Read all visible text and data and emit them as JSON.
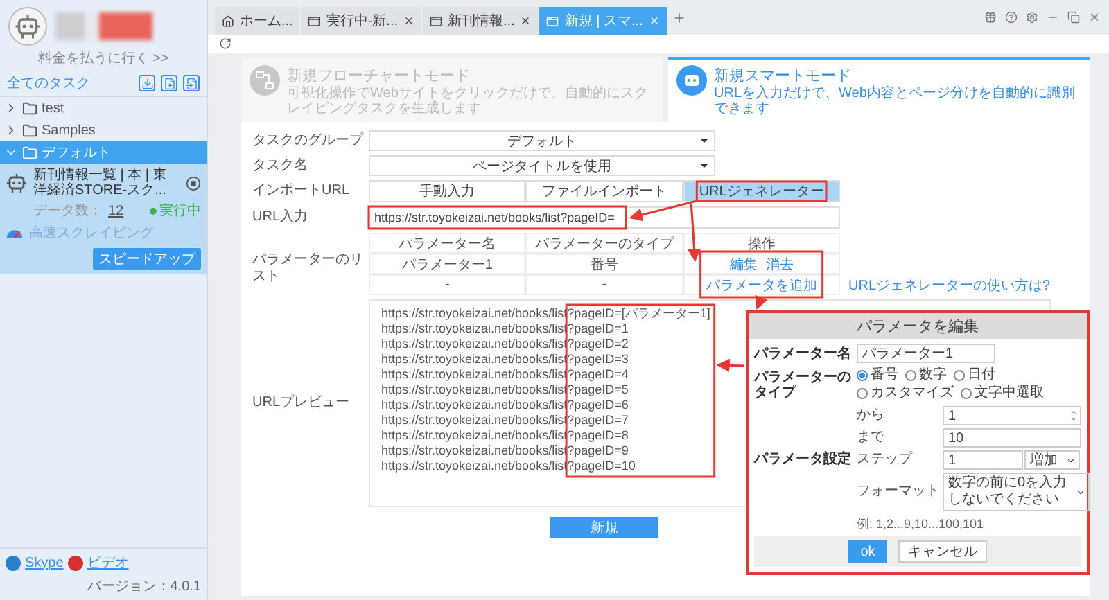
{
  "sidebar": {
    "upgrade_link": "料金を払うに行く >>",
    "all_tasks": "全てのタスク",
    "folders": [
      {
        "name": "test",
        "expanded": false,
        "selected": false
      },
      {
        "name": "Samples",
        "expanded": false,
        "selected": false
      },
      {
        "name": "デフォルト",
        "expanded": true,
        "selected": true,
        "tasks": [
          {
            "title": "新刊情報一覧 | 本 | 東洋経済STORE-スク...",
            "data_label": "データ数：",
            "data_count": "12",
            "status": "実行中",
            "speed_label": "高速スクレイピング",
            "speed_button": "スピードアップ"
          }
        ]
      }
    ],
    "footer": {
      "links": [
        {
          "label": "Skype",
          "kind": "skype"
        },
        {
          "label": "ビデオ",
          "kind": "video"
        }
      ],
      "version": "バージョン：4.0.1"
    }
  },
  "tabs": [
    {
      "label": "ホーム...",
      "kind": "home",
      "closable": false,
      "selected": false
    },
    {
      "label": "実行中-新...",
      "kind": "page",
      "closable": true,
      "selected": false
    },
    {
      "label": "新刊情報...",
      "kind": "page",
      "closable": true,
      "selected": false
    },
    {
      "label": "新規 | スマ...",
      "kind": "page",
      "closable": true,
      "selected": true
    }
  ],
  "modes": [
    {
      "title": "新規フローチャートモード",
      "description": "可視化操作でWebサイトをクリックだけで、自動的にスクレイピングタスクを生成します",
      "kind": "flowchart",
      "selected": false
    },
    {
      "title": "新規スマートモード",
      "description": "URLを入力だけで、Web内容とページ分けを自動的に識別できます",
      "kind": "smart",
      "selected": true
    }
  ],
  "form": {
    "group": {
      "label": "タスクのグループ",
      "value": "デフォルト"
    },
    "task_name": {
      "label": "タスク名",
      "value": "ページタイトルを使用"
    },
    "import": {
      "label": "インポートURL",
      "options": [
        {
          "label": "手動入力",
          "selected": false
        },
        {
          "label": "ファイルインポート",
          "selected": false
        },
        {
          "label": "URLジェネレーター",
          "selected": true
        }
      ]
    },
    "url": {
      "label": "URL入力",
      "value": "https://str.toyokeizai.net/books/list?pageID="
    },
    "params": {
      "label": "パラメーターのリスト",
      "columns": [
        "パラメーター名",
        "パラメーターのタイプ",
        "操作"
      ],
      "rows": [
        {
          "cells": [
            "パラメーター1",
            "番号"
          ],
          "actions": [
            "編集",
            "消去"
          ]
        },
        {
          "cells": [
            "-",
            "-"
          ],
          "actions": [
            "パラメータを追加"
          ]
        }
      ]
    },
    "help_link": "URLジェネレーターの使い方は?",
    "preview": {
      "label": "URLプレビュー",
      "lines": [
        "https://str.toyokeizai.net/books/list?pageID=[パラメーター1]",
        "https://str.toyokeizai.net/books/list?pageID=1",
        "https://str.toyokeizai.net/books/list?pageID=2",
        "https://str.toyokeizai.net/books/list?pageID=3",
        "https://str.toyokeizai.net/books/list?pageID=4",
        "https://str.toyokeizai.net/books/list?pageID=5",
        "https://str.toyokeizai.net/books/list?pageID=6",
        "https://str.toyokeizai.net/books/list?pageID=7",
        "https://str.toyokeizai.net/books/list?pageID=8",
        "https://str.toyokeizai.net/books/list?pageID=9",
        "https://str.toyokeizai.net/books/list?pageID=10"
      ]
    },
    "submit": "新規"
  },
  "dialog": {
    "title": "パラメータを編集",
    "name_label": "パラメーター名",
    "name_value": "パラメーター1",
    "type_label": "パラメーターのタイプ",
    "types": [
      {
        "label": "番号",
        "selected": true
      },
      {
        "label": "数字",
        "selected": false
      },
      {
        "label": "日付",
        "selected": false
      },
      {
        "label": "カスタマイズ",
        "selected": false
      },
      {
        "label": "文字中選取",
        "selected": false
      }
    ],
    "settings_label": "パラメータ設定",
    "from_label": "から",
    "from_value": "1",
    "to_label": "まで",
    "to_value": "10",
    "step_label": "ステップ",
    "step_value": "1",
    "step_mode": "増加",
    "format_label": "フォーマット",
    "format_value": "数字の前に0を入力しないでください",
    "example": "例: 1,2...9,10...100,101",
    "ok": "ok",
    "cancel": "キャンセル"
  }
}
